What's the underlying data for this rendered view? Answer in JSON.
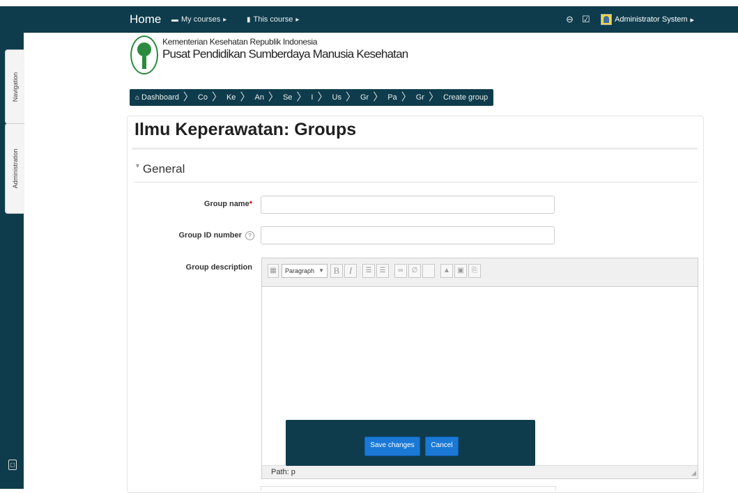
{
  "navbar": {
    "home": "Home",
    "my_courses": "My courses",
    "this_course": "This course",
    "user": "Administrator System"
  },
  "dock": {
    "navigation": "Navigation",
    "administration": "Administration"
  },
  "header": {
    "line1": "Kementerian Kesehatan Republik Indonesia",
    "line2": "Pusat Pendidikan Sumberdaya Manusia Kesehatan"
  },
  "breadcrumb": [
    "Dashboard",
    "Co",
    "Ke",
    "An",
    "Se",
    "I",
    "Us",
    "Gr",
    "Pa",
    "Gr",
    "Create group"
  ],
  "page": {
    "title": "Ilmu Keperawatan: Groups",
    "section": "General"
  },
  "form": {
    "group_name_label": "Group name",
    "group_name_value": "",
    "group_id_label": "Group ID number",
    "group_id_value": "",
    "description_label": "Group description",
    "paragraph_select": "Paragraph",
    "path_label": "Path: p"
  },
  "actions": {
    "save": "Save changes",
    "cancel": "Cancel"
  },
  "colors": {
    "navbar": "#0f3c4c",
    "primary_button": "#1a79d6"
  }
}
